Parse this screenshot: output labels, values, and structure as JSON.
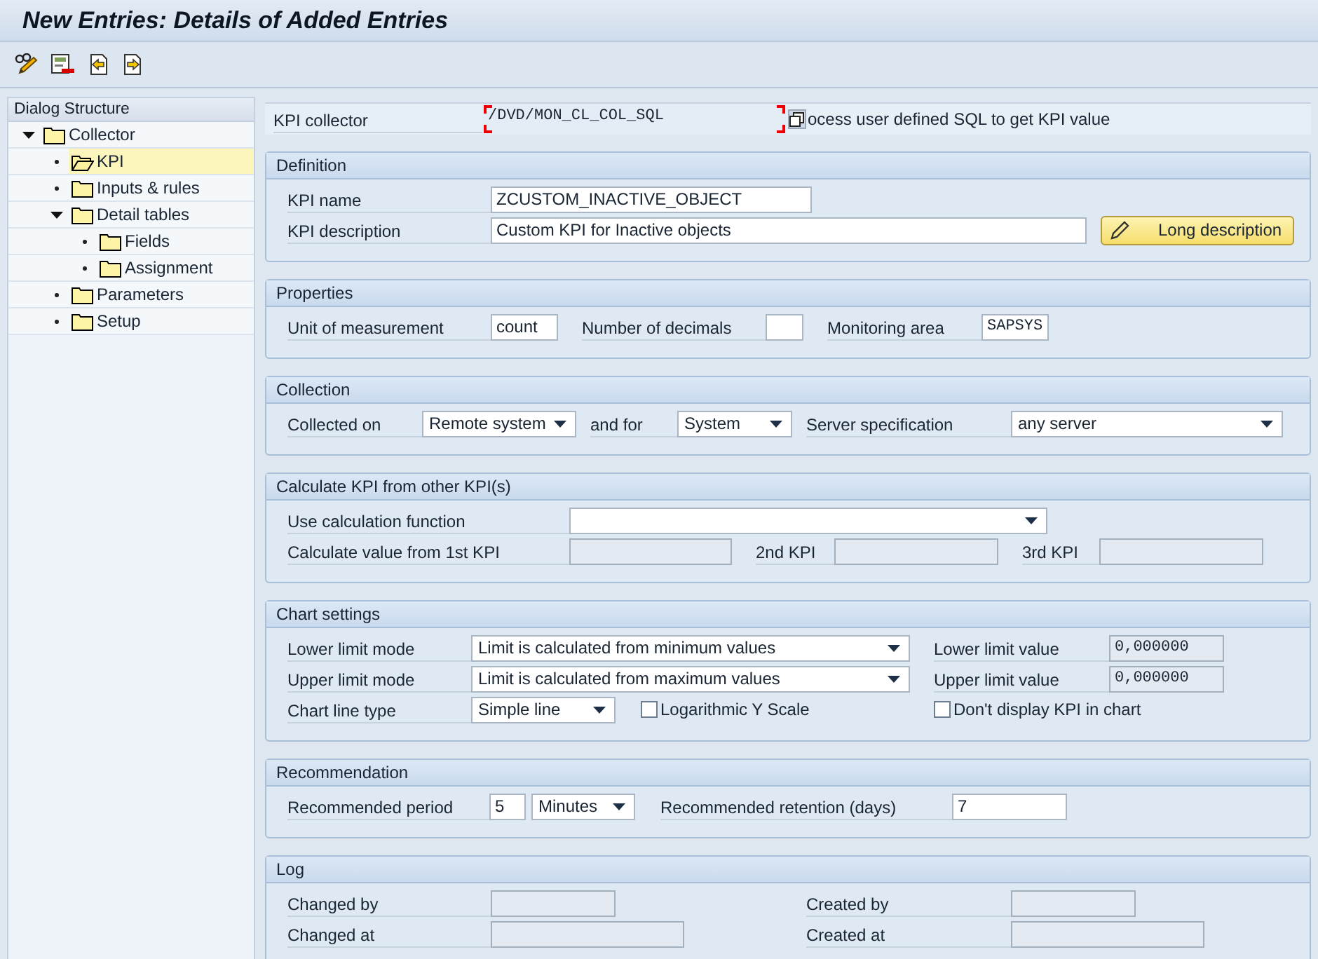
{
  "window": {
    "title": "New Entries: Details of Added Entries"
  },
  "dialog_structure": {
    "title": "Dialog Structure",
    "items": [
      {
        "label": "Collector",
        "selected": false,
        "expanded": true,
        "children": [
          {
            "label": "KPI",
            "selected": true
          },
          {
            "label": "Inputs & rules",
            "selected": false
          },
          {
            "label": "Detail tables",
            "selected": false,
            "expanded": true,
            "children": [
              {
                "label": "Fields",
                "selected": false
              },
              {
                "label": "Assignment",
                "selected": false
              }
            ]
          },
          {
            "label": "Parameters",
            "selected": false
          },
          {
            "label": "Setup",
            "selected": false
          }
        ]
      }
    ]
  },
  "kpi_collector": {
    "label": "KPI collector",
    "value": "/DVD/MON_CL_COL_SQL",
    "focused": true,
    "description": "ocess user defined SQL to get KPI value"
  },
  "definition": {
    "title": "Definition",
    "kpi_name": {
      "label": "KPI name",
      "value": "ZCUSTOM_INACTIVE_OBJECT",
      "disabled": false
    },
    "kpi_description": {
      "label": "KPI description",
      "value": "Custom KPI for Inactive objects",
      "disabled": false
    },
    "long_description_button": "Long description"
  },
  "properties": {
    "title": "Properties",
    "unit": {
      "label": "Unit of measurement",
      "value": "count",
      "disabled": false
    },
    "decimals": {
      "label": "Number of decimals",
      "disabled": false
    },
    "monitoring_area": {
      "label": "Monitoring area",
      "value": "SAPSYS",
      "disabled": false
    }
  },
  "collection": {
    "title": "Collection",
    "collected_on": {
      "label": "Collected on",
      "value": "Remote system"
    },
    "and_for": {
      "label": "and for",
      "value": "System"
    },
    "server_specification": {
      "label": "Server specification",
      "value": "any server"
    }
  },
  "calculate": {
    "title": "Calculate KPI from other KPI(s)",
    "calculation_function": {
      "label": "Use calculation function"
    },
    "kpi_1": {
      "label": "Calculate value from 1st KPI",
      "disabled": true
    },
    "kpi_2": {
      "label": "2nd KPI",
      "disabled": true
    },
    "kpi_3": {
      "label": "3rd KPI",
      "disabled": true
    }
  },
  "chart_settings": {
    "title": "Chart settings",
    "lower_limit_mode": {
      "label": "Lower limit mode",
      "value": "Limit is calculated from minimum values"
    },
    "lower_limit_value": {
      "label": "Lower limit value",
      "value": "0,000000",
      "disabled": true
    },
    "upper_limit_mode": {
      "label": "Upper limit mode",
      "value": "Limit is calculated from maximum values"
    },
    "upper_limit_value": {
      "label": "Upper limit value",
      "value": "0,000000",
      "disabled": true
    },
    "chart_line_type": {
      "label": "Chart line type",
      "value": "Simple line"
    },
    "logarithmic": {
      "label": "Logarithmic Y Scale",
      "checked": false
    },
    "hide_in_chart": {
      "label": "Don't display KPI in chart",
      "checked": false
    }
  },
  "recommendation": {
    "title": "Recommendation",
    "period": {
      "label": "Recommended period",
      "value": "5",
      "disabled": false
    },
    "period_unit": {
      "value": "Minutes"
    },
    "retention": {
      "label": "Recommended retention (days)",
      "value": "7",
      "disabled": false
    }
  },
  "log": {
    "title": "Log",
    "changed_by": {
      "label": "Changed by",
      "disabled": true
    },
    "created_by": {
      "label": "Created by",
      "disabled": true
    },
    "changed_at": {
      "label": "Changed at",
      "disabled": true
    },
    "created_at": {
      "label": "Created at",
      "disabled": true
    }
  }
}
